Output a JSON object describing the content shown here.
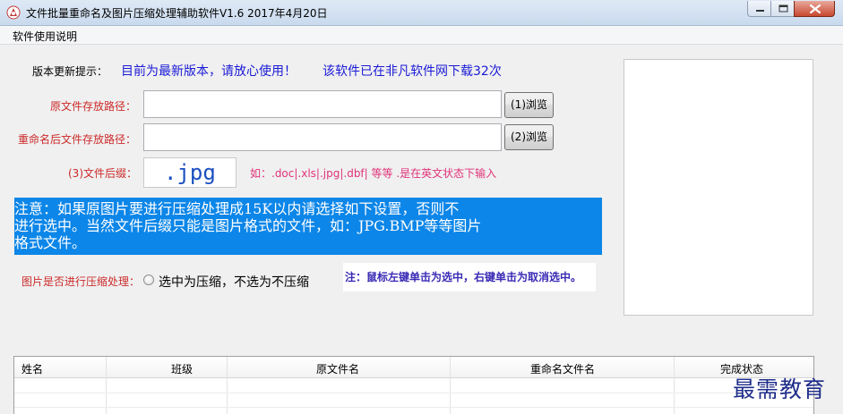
{
  "window": {
    "title": "文件批量重命名及图片压缩处理辅助软件V1.6  2017年4月20日"
  },
  "menu": {
    "help": "软件使用说明"
  },
  "update": {
    "label": "版本更新提示：",
    "message": "目前为最新版本，请放心使用！",
    "downloads": "该软件已在非凡软件网下载32次"
  },
  "source": {
    "label": "原文件存放路径：",
    "value": "",
    "browse_label": "(1)浏览"
  },
  "target": {
    "label": "重命名后文件存放路径：",
    "value": "",
    "browse_label": "(2)浏览"
  },
  "extension": {
    "label": "(3)文件后缀：",
    "value": ".jpg",
    "hint": "如：.doc|.xls|.jpg|.dbf|  等等  .是在英文状态下输入"
  },
  "notice": {
    "line1": "    注意：如果原图片要进行压缩处理成15K以内请选择如下设置，否则不",
    "line2": "进行选中。当然文件后缀只能是图片格式的文件，如：JPG.BMP等等图片",
    "line3": "格式文件。"
  },
  "compress": {
    "label": "图片是否进行压缩处理：",
    "option_label": "选中为压缩，不选为不压缩",
    "checked": false,
    "tip": "注：鼠标左键单击为选中，右键单击为取消选中。"
  },
  "table": {
    "columns": [
      "姓名",
      "班级",
      "原文件名",
      "重命名文件名",
      "完成状态"
    ],
    "rows": []
  },
  "watermark": "最需教育",
  "colors": {
    "label_red": "#cc2a2a",
    "info_blue": "#1a1ad6",
    "notice_bg": "#0c86e8",
    "hint_pink": "#e0337a",
    "tip_purple": "#3a2ab5"
  }
}
